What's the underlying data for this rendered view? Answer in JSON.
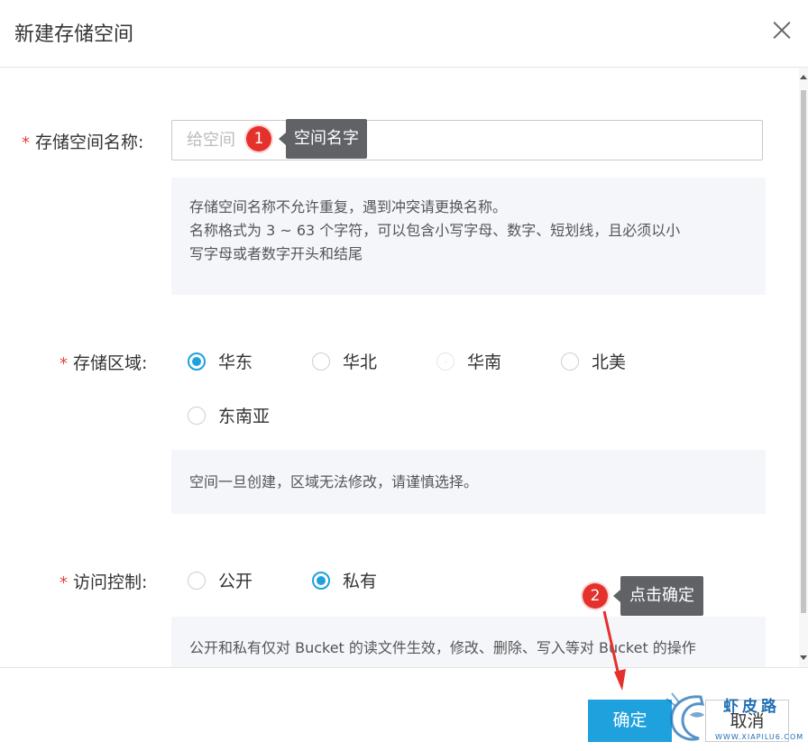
{
  "dialog": {
    "title": "新建存储空间"
  },
  "form": {
    "name": {
      "label": "存储空间名称:",
      "placeholder": "给空间",
      "value": "",
      "help": [
        "存储空间名称不允许重复，遇到冲突请更换名称。",
        "名称格式为 3 ~ 63 个字符，可以包含小写字母、数字、短划线，且必须以小",
        "写字母或者数字开头和结尾"
      ]
    },
    "region": {
      "label": "存储区域:",
      "options": [
        "华东",
        "华北",
        "华南",
        "北美",
        "东南亚"
      ],
      "selected": "华东",
      "help": "空间一旦创建，区域无法修改，请谨慎选择。"
    },
    "access": {
      "label": "访问控制:",
      "options": [
        "公开",
        "私有"
      ],
      "selected": "私有",
      "help": "公开和私有仅对 Bucket 的读文件生效，修改、删除、写入等对 Bucket 的操作"
    }
  },
  "annotations": {
    "step1": {
      "number": "1",
      "text": "空间名字"
    },
    "step2": {
      "number": "2",
      "text": "点击确定"
    }
  },
  "footer": {
    "ok_label": "确定",
    "cancel_label": "取消"
  },
  "watermark": {
    "name": "虾皮路",
    "url": "WWW.XIAPILU6.COM"
  },
  "colors": {
    "primary": "#1ea1dd",
    "required": "#e64340",
    "badge": "#e5312c",
    "tooltip": "#606266",
    "help_bg": "#f4f6fa"
  }
}
